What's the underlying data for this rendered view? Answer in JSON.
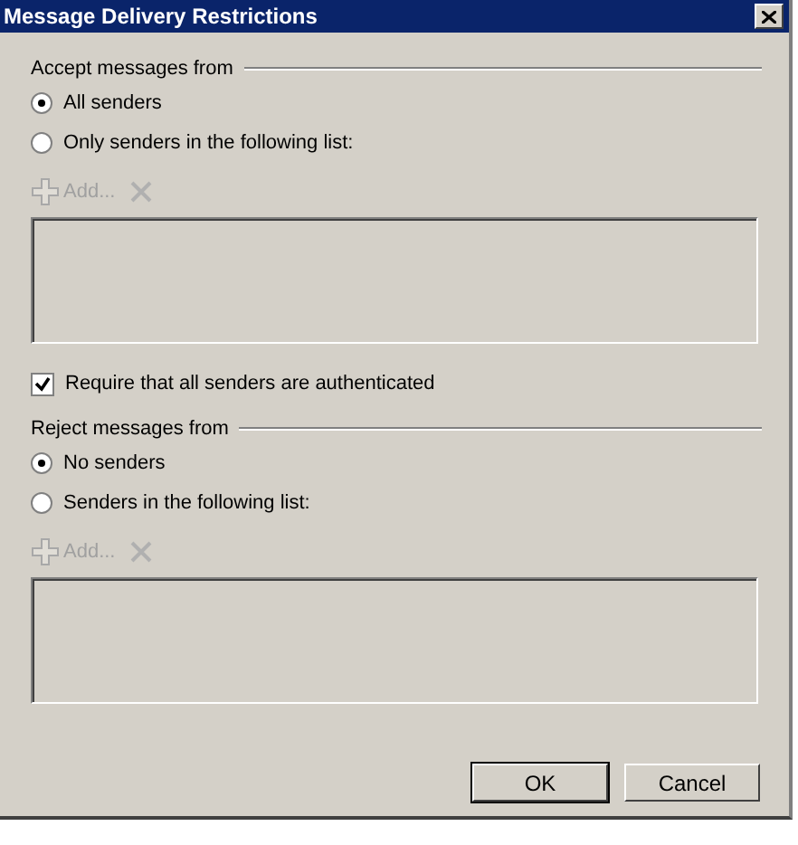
{
  "window": {
    "title": "Message Delivery Restrictions"
  },
  "accept": {
    "heading": "Accept messages from",
    "options": [
      {
        "label": "All senders",
        "selected": true
      },
      {
        "label": "Only senders in the following list:",
        "selected": false
      }
    ],
    "add_button": {
      "label": "Add...",
      "disabled": true
    },
    "remove_button": {
      "disabled": true
    }
  },
  "require_authentication": {
    "label": "Require that all senders are authenticated",
    "checked": true
  },
  "reject": {
    "heading": "Reject messages from",
    "options": [
      {
        "label": "No senders",
        "selected": true
      },
      {
        "label": "Senders in the following list:",
        "selected": false
      }
    ],
    "add_button": {
      "label": "Add...",
      "disabled": true
    },
    "remove_button": {
      "disabled": true
    }
  },
  "buttons": [
    {
      "label": "OK",
      "default": true
    },
    {
      "label": "Cancel",
      "default": false
    }
  ]
}
